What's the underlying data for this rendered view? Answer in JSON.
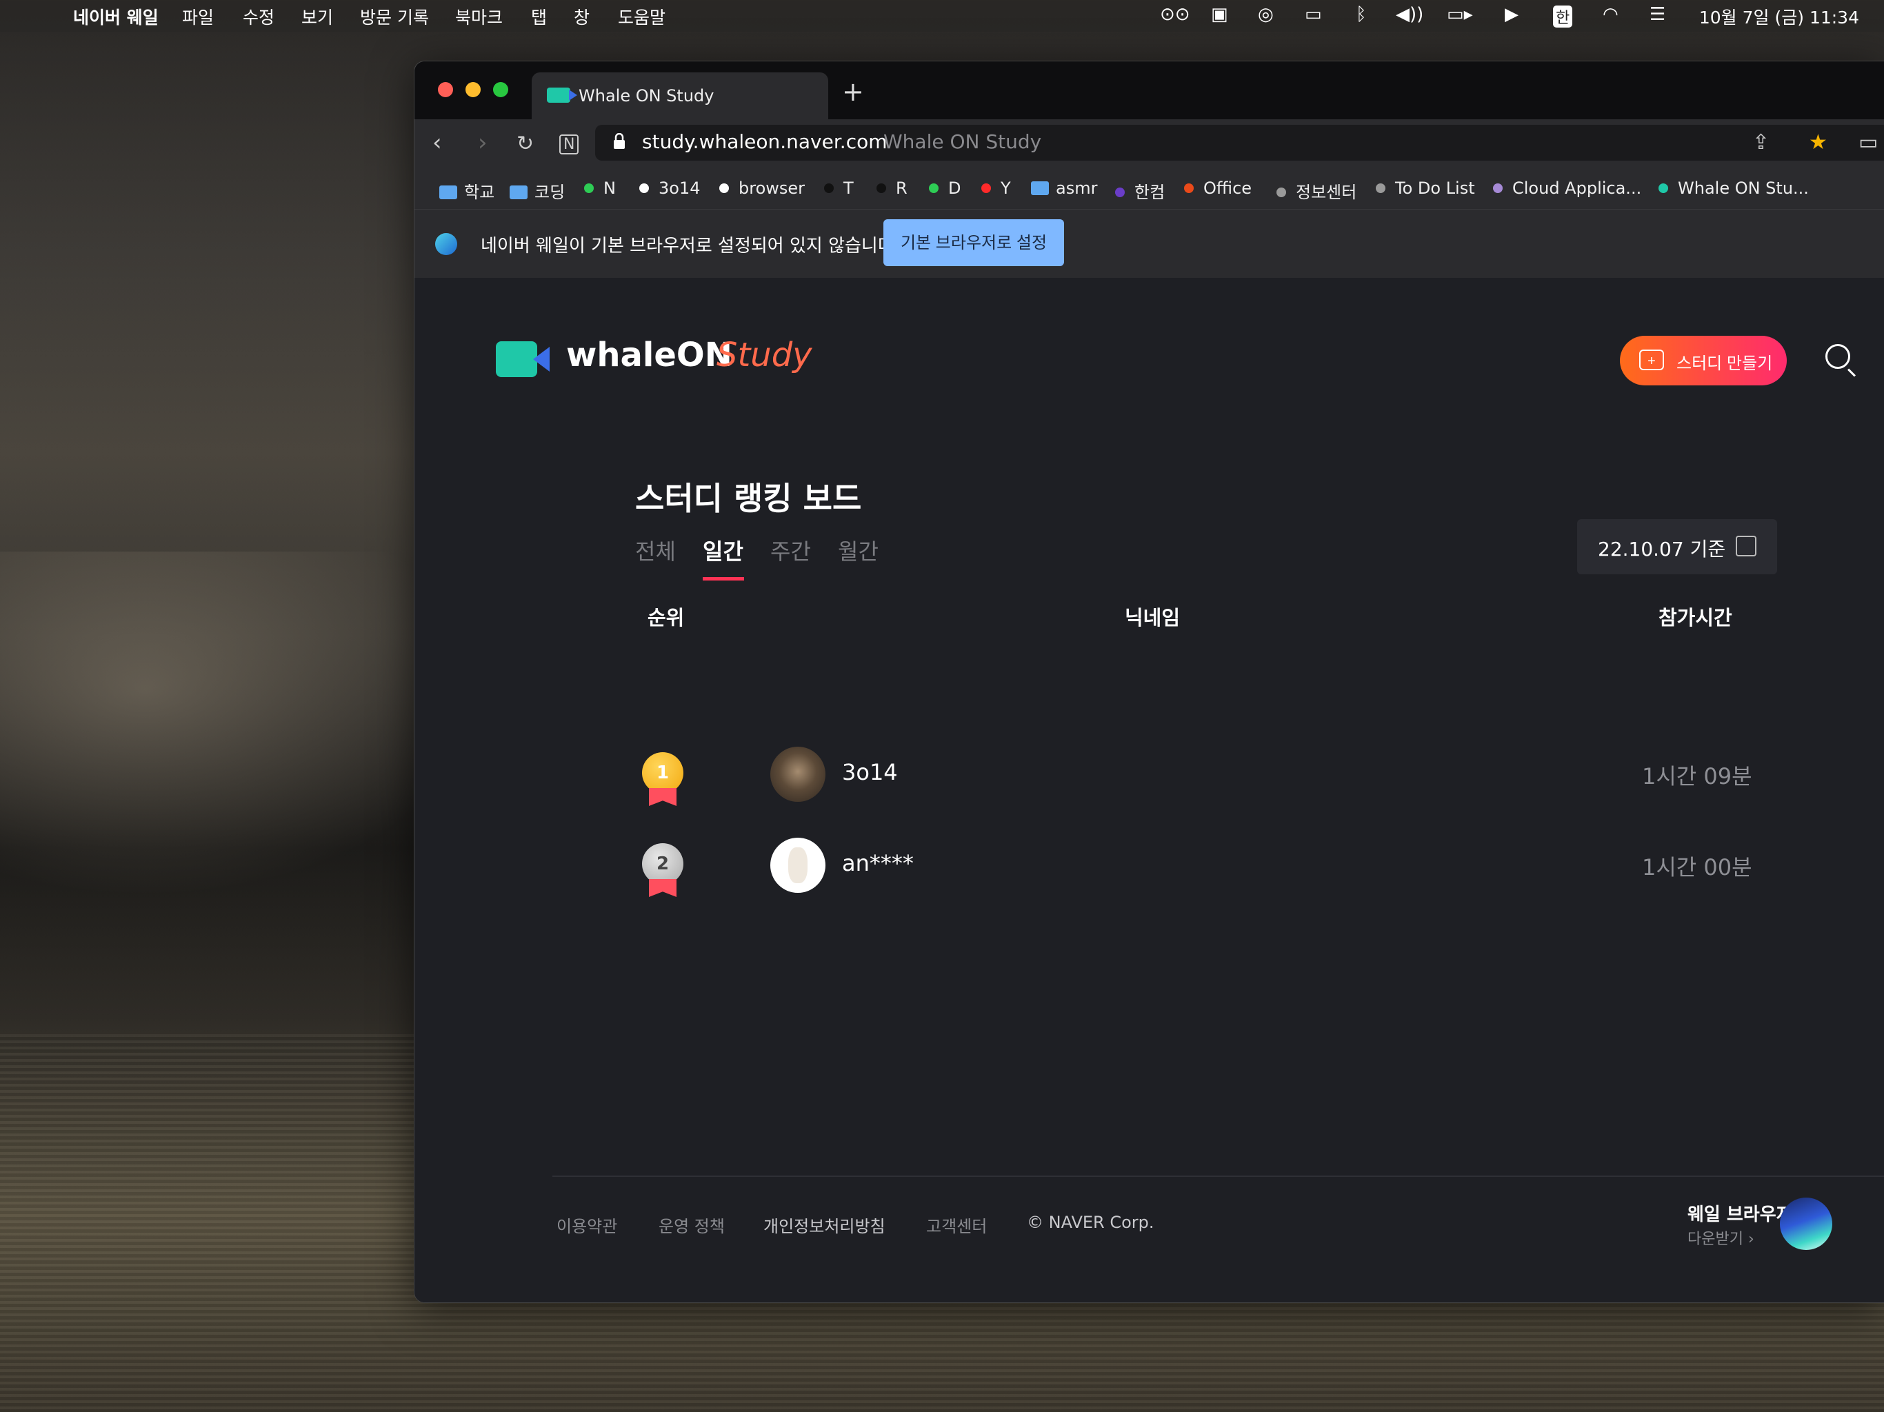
{
  "menubar": {
    "app_name": "네이버 웨일",
    "menus": [
      "파일",
      "수정",
      "보기",
      "방문 기록",
      "북마크",
      "탭",
      "창",
      "도움말"
    ],
    "input_method": "한",
    "clock": "10월 7일 (금)  11:34"
  },
  "browser": {
    "tab_title": "Whale ON Study",
    "url": "study.whaleon.naver.com",
    "page_title": "Whale ON Study",
    "bookmarks": [
      {
        "label": "학교",
        "kind": "folder",
        "color": "#5fa8f0"
      },
      {
        "label": "코딩",
        "kind": "folder",
        "color": "#5fa8f0"
      },
      {
        "label": "N",
        "kind": "dot",
        "color": "#2ecc55"
      },
      {
        "label": "3o14",
        "kind": "dot",
        "color": "#ffffff"
      },
      {
        "label": "browser",
        "kind": "dot",
        "color": "#ffffff"
      },
      {
        "label": "T",
        "kind": "dot",
        "color": "#111111"
      },
      {
        "label": "R",
        "kind": "dot",
        "color": "#111111"
      },
      {
        "label": "D",
        "kind": "dot",
        "color": "#2ecc55"
      },
      {
        "label": "Y",
        "kind": "dot",
        "color": "#ff2a2a"
      },
      {
        "label": "asmr",
        "kind": "folder",
        "color": "#5fa8f0"
      },
      {
        "label": "한컴",
        "kind": "dot",
        "color": "#6a3dc8"
      },
      {
        "label": "Office",
        "kind": "dot",
        "color": "#ea4a1a"
      },
      {
        "label": "정보센터",
        "kind": "dot",
        "color": "#9a9a9a"
      },
      {
        "label": "To Do List",
        "kind": "dot",
        "color": "#9a9a9a"
      },
      {
        "label": "Cloud Applica...",
        "kind": "dot",
        "color": "#a68ad6"
      },
      {
        "label": "Whale ON Stu...",
        "kind": "dot",
        "color": "#1fc8a8"
      }
    ],
    "infobar": {
      "message": "네이버 웨일이 기본 브라우저로 설정되어 있지 않습니다",
      "button": "기본 브라우저로 설정"
    }
  },
  "page": {
    "logo_main": "whaleON",
    "logo_accent": "Study",
    "create_button": "스터디 만들기",
    "board_title": "스터디 랭킹 보드",
    "period_tabs": [
      "전체",
      "일간",
      "주간",
      "월간"
    ],
    "active_tab": "일간",
    "date_label": "22.10.07 기준",
    "columns": {
      "rank": "순위",
      "nickname": "닉네임",
      "time": "참가시간"
    },
    "rows": [
      {
        "rank": "1",
        "nickname": "3o14",
        "time": "1시간 09분"
      },
      {
        "rank": "2",
        "nickname": "an****",
        "time": "1시간 00분"
      }
    ],
    "footer": {
      "links": [
        "이용약관",
        "운영 정책",
        "개인정보처리방침",
        "고객센터"
      ],
      "copyright": "© NAVER Corp.",
      "download_title": "웨일 브라우저",
      "download_sub": "다운받기 ›"
    }
  },
  "colors": {
    "accent_red": "#ff3355",
    "create_gradient_start": "#ff6b1a",
    "create_gradient_end": "#ff2b6d",
    "infobar_button": "#7fb8ff",
    "page_bg": "#1e1f24"
  }
}
